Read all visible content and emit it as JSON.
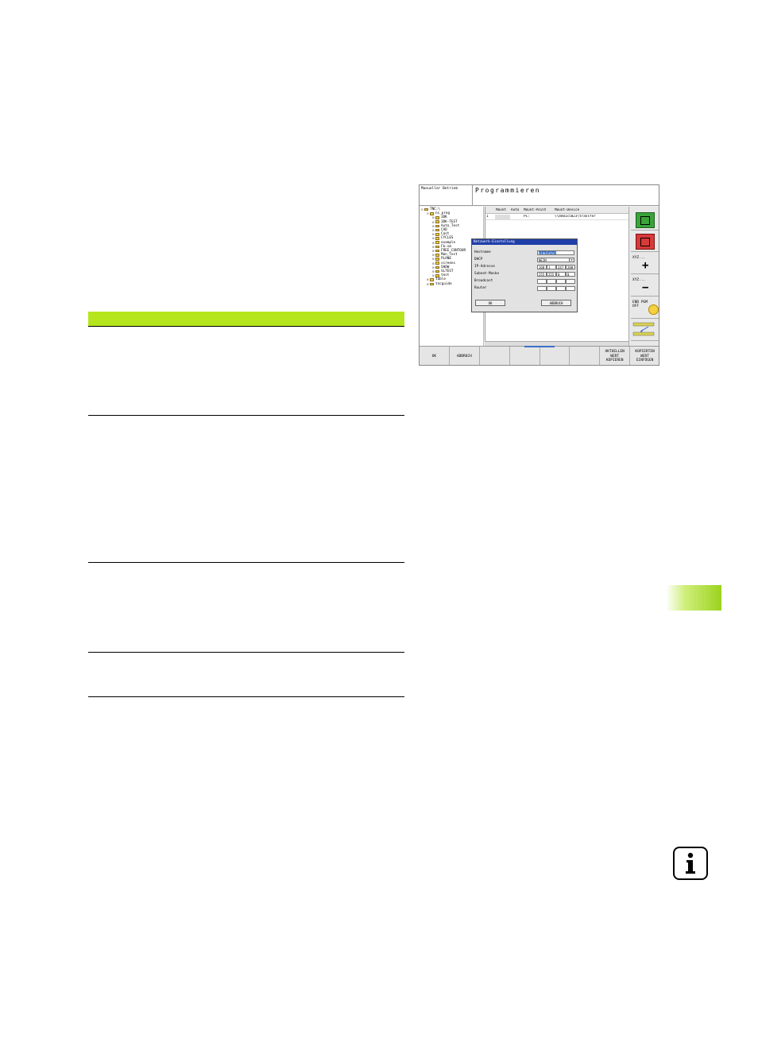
{
  "screen": {
    "mode_label": "Manueller Betrieb",
    "program_label": "Programmieren",
    "tree": [
      {
        "label": "TNC:\\",
        "level": 0,
        "expander": "⊟"
      },
      {
        "label": "nc_prog",
        "level": 1,
        "expander": "⊟"
      },
      {
        "label": "3DK",
        "level": 2,
        "expander": "⊞"
      },
      {
        "label": "3DK-TEST",
        "level": 2,
        "expander": "⊞"
      },
      {
        "label": "Auto_Test",
        "level": 2,
        "expander": "⊞"
      },
      {
        "label": "CAD",
        "level": 2,
        "expander": "⊞"
      },
      {
        "label": "Cast",
        "level": 2,
        "expander": "⊞"
      },
      {
        "label": "CYCLES",
        "level": 2,
        "expander": "⊞"
      },
      {
        "label": "example",
        "level": 2,
        "expander": "⊞"
      },
      {
        "label": "Fk-sm",
        "level": 2,
        "expander": "⊞"
      },
      {
        "label": "FREE_CONTOUR",
        "level": 2,
        "expander": "⊞"
      },
      {
        "label": "Man_Test",
        "level": 2,
        "expander": "⊞"
      },
      {
        "label": "PLANE",
        "level": 2,
        "expander": "⊞"
      },
      {
        "label": "screens",
        "level": 2,
        "expander": "⊞"
      },
      {
        "label": "SHOW",
        "level": 2,
        "expander": "⊞"
      },
      {
        "label": "SLTEST",
        "level": 2,
        "expander": "⊞"
      },
      {
        "label": "test",
        "level": 2,
        "expander": "⊞"
      },
      {
        "label": "table",
        "level": 1,
        "expander": "⊞"
      },
      {
        "label": "tncguide",
        "level": 1,
        "expander": "⊞"
      }
    ],
    "mount_table": {
      "columns": [
        "",
        "Mount",
        "Auto",
        "Mount-Point",
        "Mount-Device"
      ],
      "rows": [
        [
          "1",
          "",
          "",
          "PC:",
          "\\\\de01c5023\\transfer"
        ]
      ]
    },
    "dialog": {
      "title": "Netzwerk-Einstellung",
      "labels": [
        "Hostname",
        "DHCP",
        "IP-Adresse",
        "Subnet-Maske",
        "Broadcast",
        "Router"
      ],
      "hostname": "simulator",
      "dhcp": "NEIN",
      "ip": [
        "160",
        "1",
        "247",
        "200"
      ],
      "subnet": [
        "255",
        "255",
        "0",
        "0"
      ],
      "ok": "OK",
      "cancel": "ABBRUCH"
    },
    "side_keys": {
      "xyz_plus": "XYZ...",
      "xyz_minus": "XYZ...",
      "end_pgm": "END PGM\nOFF"
    },
    "soft_keys": [
      "OK",
      "ABBRUCH",
      "",
      "",
      "",
      "",
      "AKTUELLEN\nWERT\nKOPIEREN",
      "KOPIERTEN\nWERT\nEINFÜGEN"
    ]
  },
  "colors": {
    "accent_green": "#b5e61d",
    "dialog_title": "#1f3fa8"
  }
}
